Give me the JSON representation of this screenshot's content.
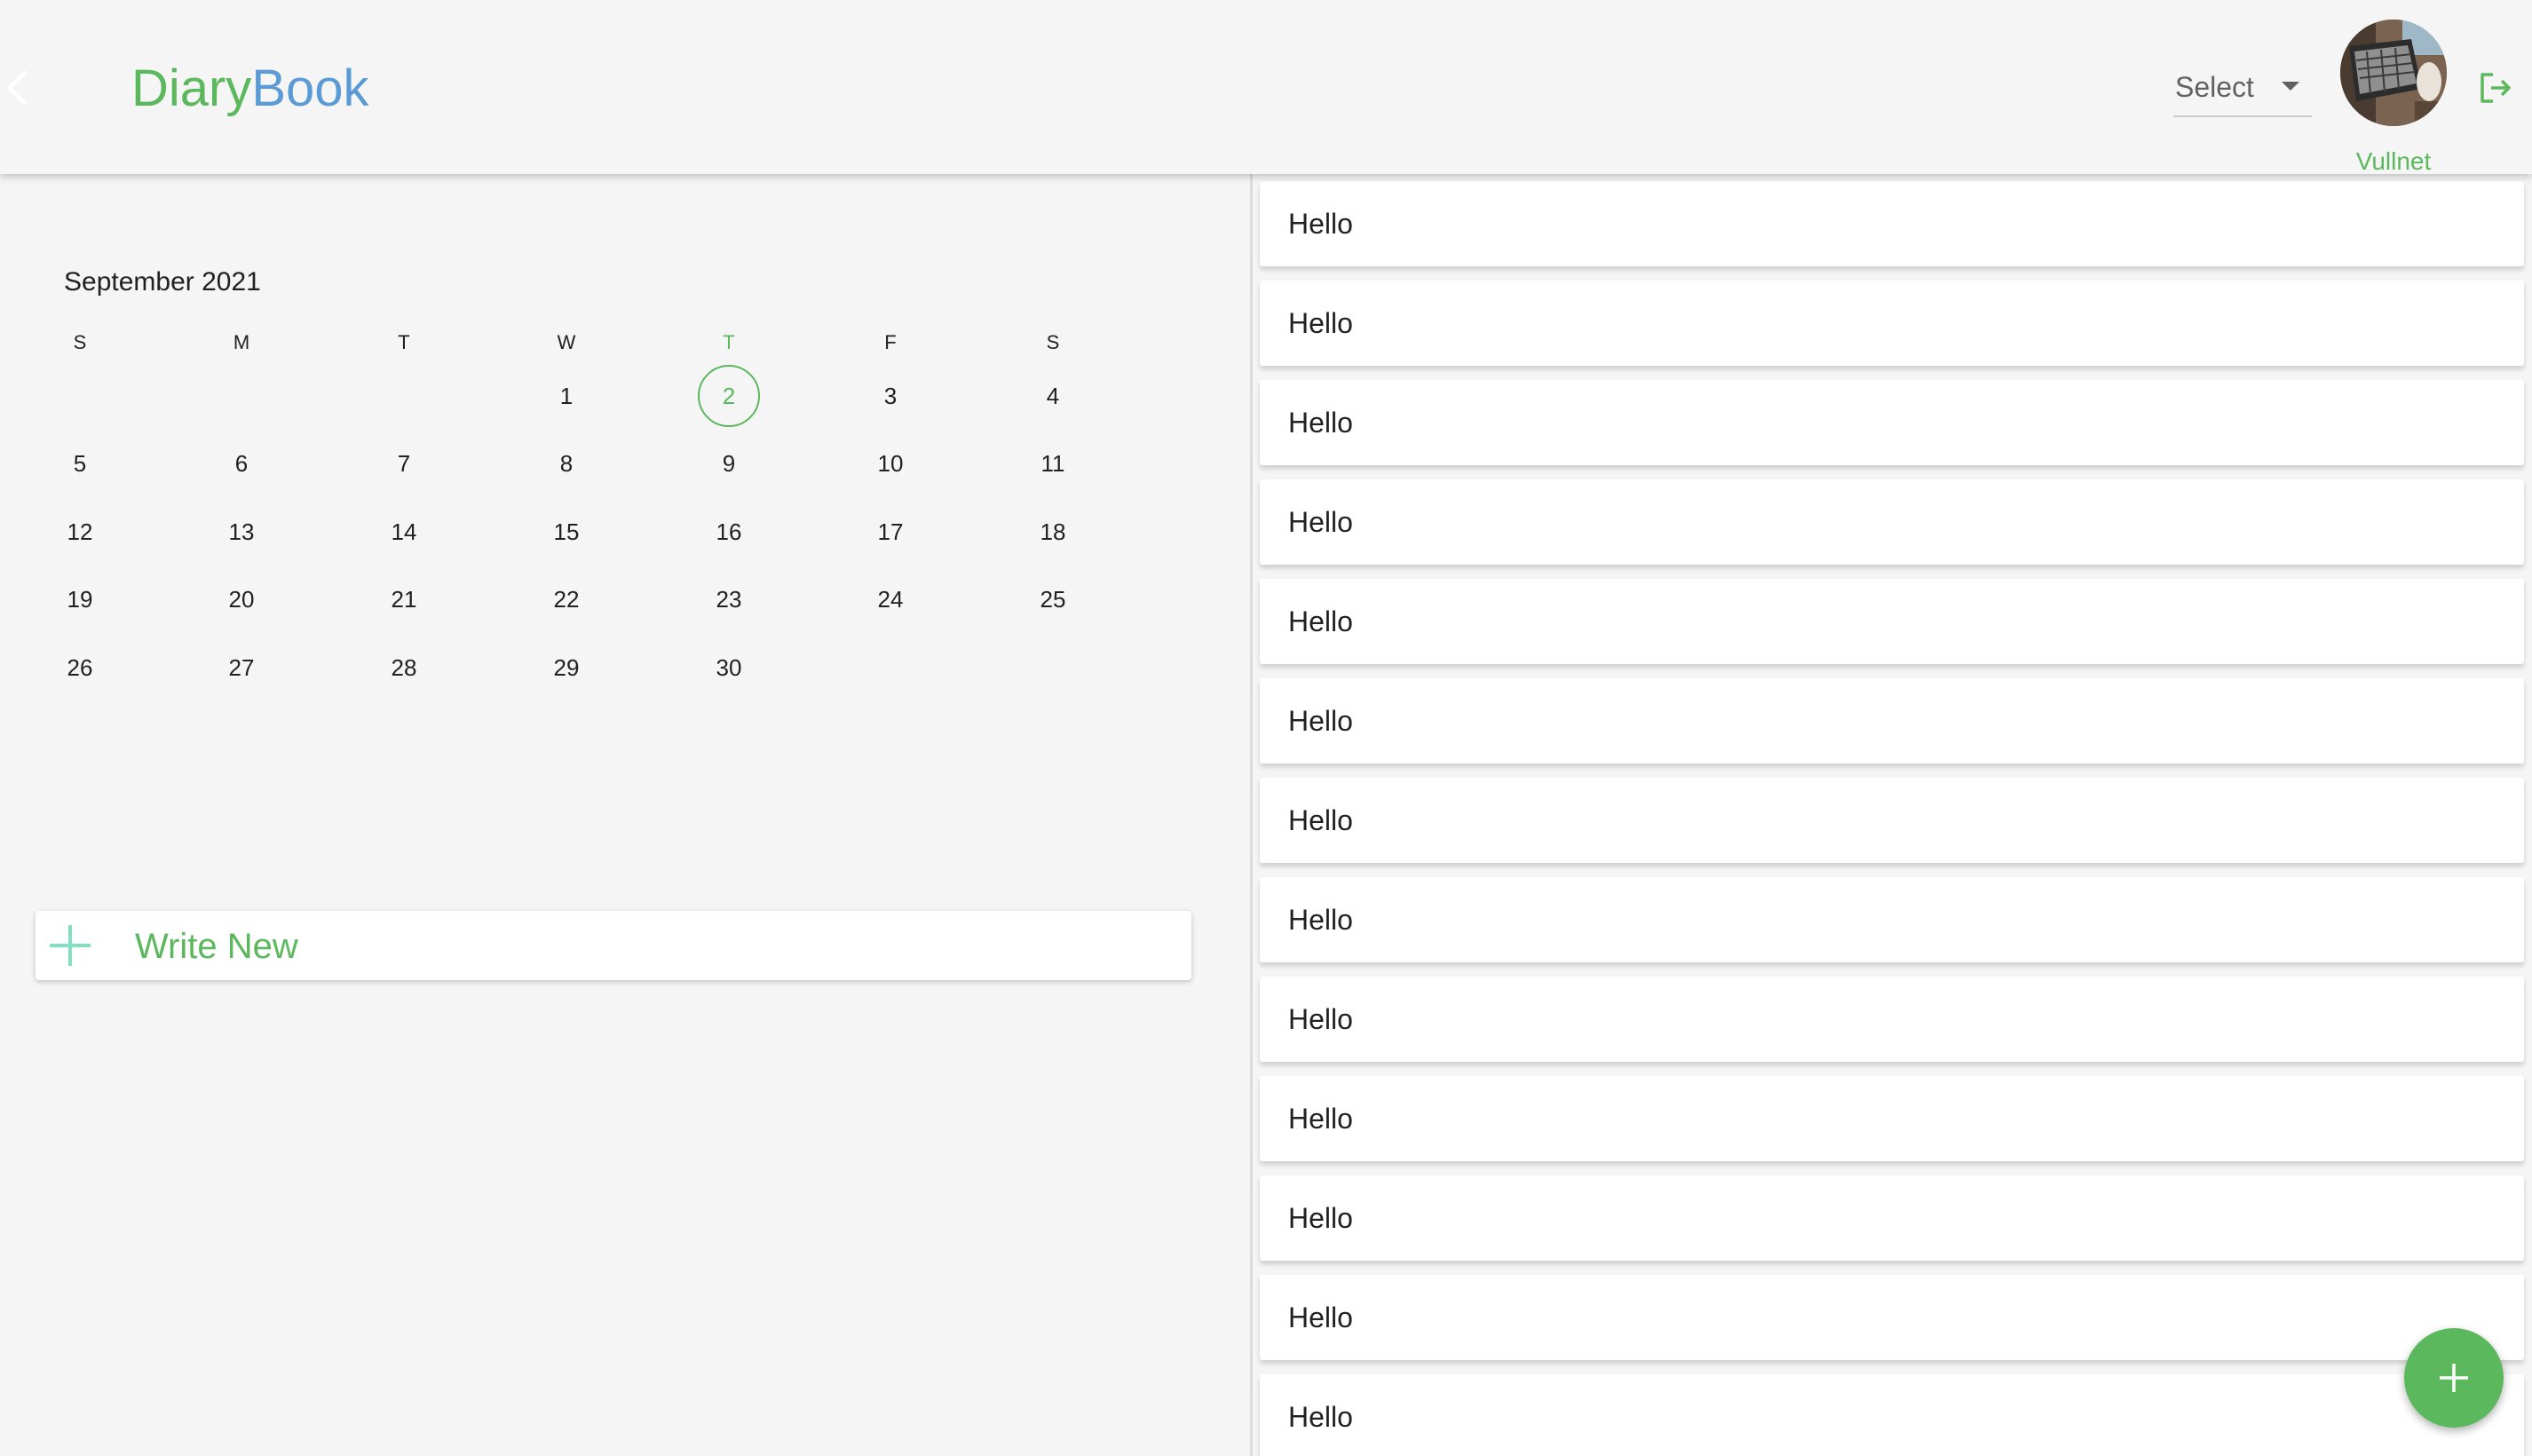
{
  "header": {
    "logo_part1": "Diary",
    "logo_part2": "Book",
    "select_label": "Select",
    "username": "Vullnet",
    "icons": {
      "back": "chevron-left-icon",
      "logout": "logout-icon",
      "caret": "caret-down-icon"
    }
  },
  "calendar": {
    "month_label": "September 2021",
    "weekdays": [
      "S",
      "M",
      "T",
      "W",
      "T",
      "F",
      "S"
    ],
    "today_weekday_index": 4,
    "selected_day": "2",
    "weeks": [
      [
        "",
        "",
        "",
        "1",
        "2",
        "3",
        "4"
      ],
      [
        "5",
        "6",
        "7",
        "8",
        "9",
        "10",
        "11"
      ],
      [
        "12",
        "13",
        "14",
        "15",
        "16",
        "17",
        "18"
      ],
      [
        "19",
        "20",
        "21",
        "22",
        "23",
        "24",
        "25"
      ],
      [
        "26",
        "27",
        "28",
        "29",
        "30",
        "",
        ""
      ]
    ]
  },
  "write_new": {
    "label": "Write New",
    "icon": "plus-icon"
  },
  "entries": [
    "Hello",
    "Hello",
    "Hello",
    "Hello",
    "Hello",
    "Hello",
    "Hello",
    "Hello",
    "Hello",
    "Hello",
    "Hello",
    "Hello",
    "Hello"
  ],
  "fab": {
    "icon": "plus-icon"
  },
  "colors": {
    "accent_green": "#5cb85c",
    "accent_blue": "#5b9bd5",
    "background": "#f5f5f5",
    "plus_teal": "#7fe0c2"
  }
}
